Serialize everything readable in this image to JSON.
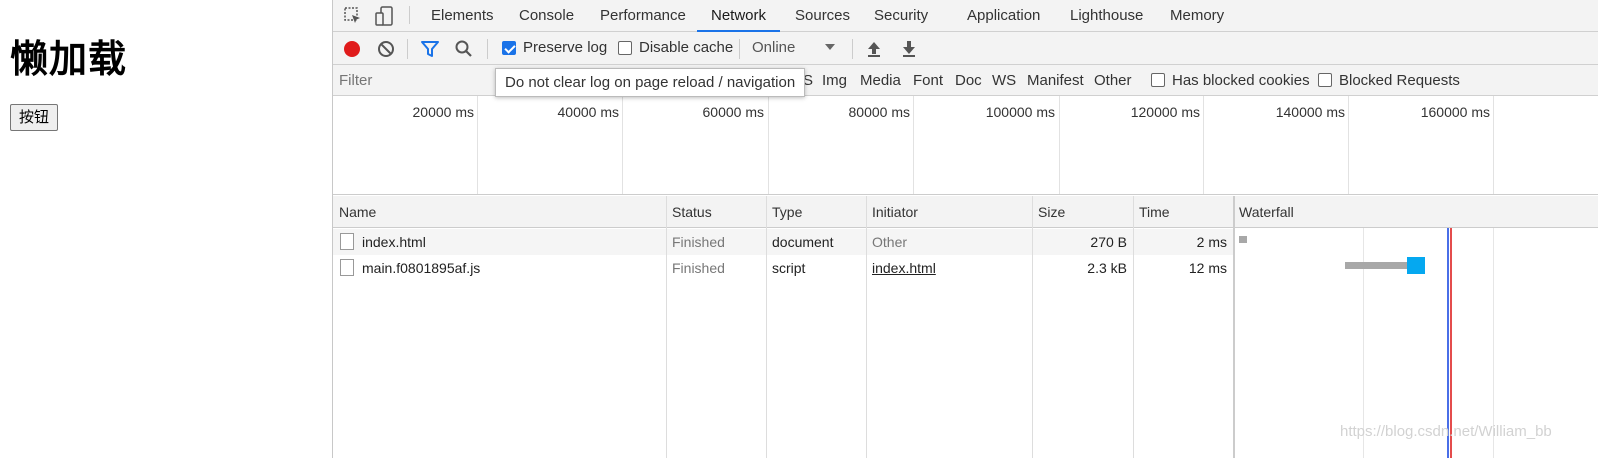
{
  "page": {
    "heading": "懒加载",
    "button_label": "按钮"
  },
  "devtools": {
    "tabs": [
      "Elements",
      "Console",
      "Performance",
      "Network",
      "Sources",
      "Security",
      "Application",
      "Lighthouse",
      "Memory"
    ],
    "active_tab": "Network",
    "toolbar": {
      "preserve_log_label": "Preserve log",
      "preserve_log_checked": true,
      "disable_cache_label": "Disable cache",
      "disable_cache_checked": false,
      "throttle_value": "Online"
    },
    "filter": {
      "placeholder": "Filter",
      "types": [
        "S",
        "Img",
        "Media",
        "Font",
        "Doc",
        "WS",
        "Manifest",
        "Other"
      ],
      "has_blocked_cookies_label": "Has blocked cookies",
      "blocked_requests_label": "Blocked Requests"
    },
    "tooltip": "Do not clear log on page reload / navigation",
    "overview_ticks": [
      "20000 ms",
      "40000 ms",
      "60000 ms",
      "80000 ms",
      "100000 ms",
      "120000 ms",
      "140000 ms",
      "160000 ms"
    ],
    "columns": [
      "Name",
      "Status",
      "Type",
      "Initiator",
      "Size",
      "Time",
      "Waterfall"
    ],
    "rows": [
      {
        "name": "index.html",
        "status": "Finished",
        "type": "document",
        "initiator": "Other",
        "size": "270 B",
        "time": "2 ms"
      },
      {
        "name": "main.f0801895af.js",
        "status": "Finished",
        "type": "script",
        "initiator": "index.html",
        "size": "2.3 kB",
        "time": "12 ms"
      }
    ],
    "colors": {
      "accent": "#1a73e8",
      "record": "#e01b1b",
      "waterfall_waiting": "#a8a8a8",
      "waterfall_download": "#05a8f0",
      "load_line": "#e44c4c",
      "dcl_line": "#4a6fe8"
    }
  },
  "watermark": "https://blog.csdn.net/William_bb"
}
